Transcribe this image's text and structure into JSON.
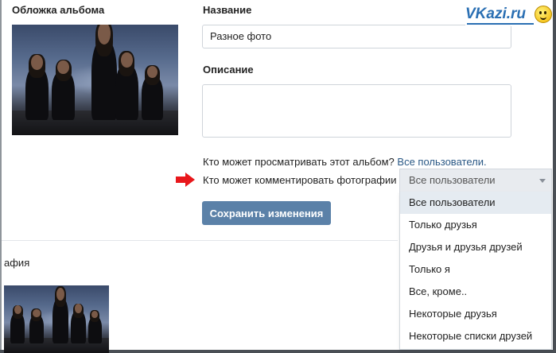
{
  "album_form": {
    "cover_label": "Обложка альбома",
    "name_label": "Название",
    "name_value": "Разное фото",
    "description_label": "Описание",
    "description_value": "",
    "view_privacy_question": "Кто может просматривать этот альбом?",
    "view_privacy_value": "Все пользователи.",
    "comment_privacy_question": "Кто может комментировать фотографии",
    "comment_privacy_selected": "Все пользователи",
    "comment_privacy_options": [
      "Все пользователи",
      "Только друзья",
      "Друзья и друзья друзей",
      "Только я",
      "Все, кроме..",
      "Некоторые друзья",
      "Некоторые списки друзей"
    ],
    "save_button": "Сохранить изменения"
  },
  "photo_section": {
    "label": "афия"
  },
  "watermark": {
    "text": "VKazi.ru"
  },
  "colors": {
    "accent": "#5b81a8",
    "link": "#2a5885",
    "arrow": "#e8171b",
    "selected_option_bg": "#e5ebf1"
  },
  "icons": [
    "red-arrow-icon",
    "chevron-down-icon",
    "smiley-icon"
  ]
}
